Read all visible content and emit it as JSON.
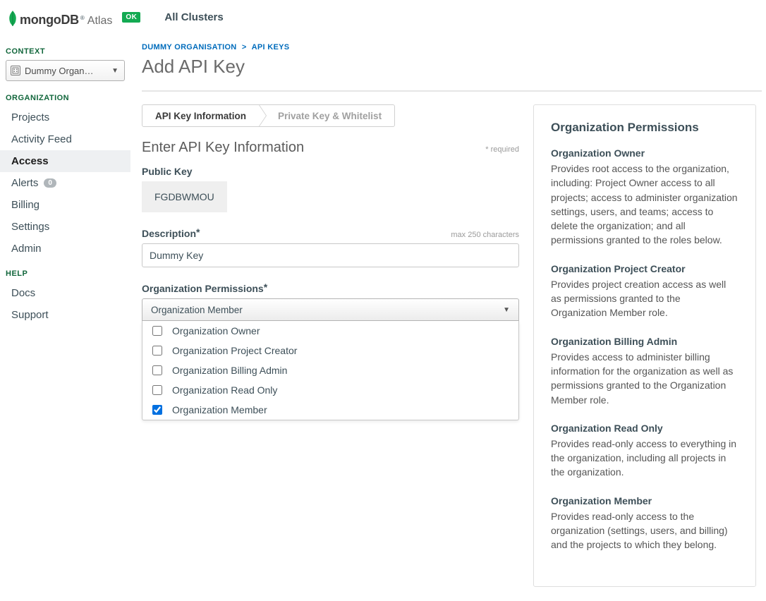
{
  "header": {
    "logo_main": "mongoDB",
    "logo_sub": "Atlas",
    "ok_badge": "OK",
    "all_clusters": "All Clusters"
  },
  "sidebar": {
    "context_label": "CONTEXT",
    "context_value": "Dummy Organ…",
    "sections": [
      {
        "label": "ORGANIZATION",
        "items": [
          {
            "label": "Projects",
            "active": false
          },
          {
            "label": "Activity Feed",
            "active": false
          },
          {
            "label": "Access",
            "active": true
          },
          {
            "label": "Alerts",
            "active": false,
            "badge": "0"
          },
          {
            "label": "Billing",
            "active": false
          },
          {
            "label": "Settings",
            "active": false
          },
          {
            "label": "Admin",
            "active": false
          }
        ]
      },
      {
        "label": "HELP",
        "items": [
          {
            "label": "Docs",
            "active": false
          },
          {
            "label": "Support",
            "active": false
          }
        ]
      }
    ]
  },
  "breadcrumb": {
    "org": "DUMMY ORGANISATION",
    "sep": ">",
    "page": "API KEYS"
  },
  "page_title": "Add API Key",
  "stepper": {
    "step1": "API Key Information",
    "step2": "Private Key & Whitelist"
  },
  "form": {
    "heading": "Enter API Key Information",
    "required_note": "* required",
    "public_key_label": "Public Key",
    "public_key_value": "FGDBWMOU",
    "description_label": "Description",
    "description_hint": "max 250 characters",
    "description_value": "Dummy Key",
    "permissions_label": "Organization Permissions",
    "permissions_selected": "Organization Member",
    "permissions_options": [
      {
        "label": "Organization Owner",
        "checked": false
      },
      {
        "label": "Organization Project Creator",
        "checked": false
      },
      {
        "label": "Organization Billing Admin",
        "checked": false
      },
      {
        "label": "Organization Read Only",
        "checked": false
      },
      {
        "label": "Organization Member",
        "checked": true
      }
    ]
  },
  "help_panel": {
    "title": "Organization Permissions",
    "blocks": [
      {
        "title": "Organization Owner",
        "desc": "Provides root access to the organization, including: Project Owner access to all projects; access to administer organization settings, users, and teams; access to delete the organization; and all permissions granted to the roles below."
      },
      {
        "title": "Organization Project Creator",
        "desc": "Provides project creation access as well as permissions granted to the Organization Member role."
      },
      {
        "title": "Organization Billing Admin",
        "desc": "Provides access to administer billing information for the organization as well as permissions granted to the Organization Member role."
      },
      {
        "title": "Organization Read Only",
        "desc": "Provides read-only access to everything in the organization, including all projects in the organization."
      },
      {
        "title": "Organization Member",
        "desc": "Provides read-only access to the organization (settings, users, and billing) and the projects to which they belong."
      }
    ]
  }
}
